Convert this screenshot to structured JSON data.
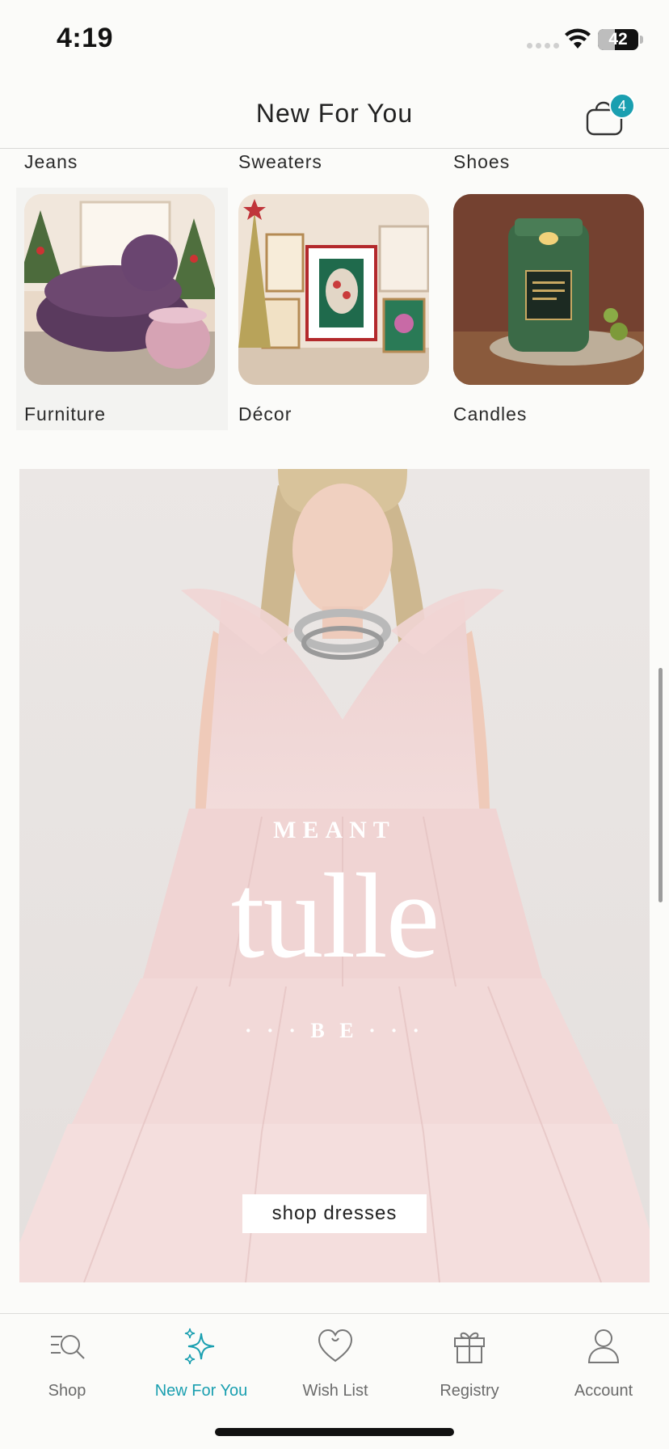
{
  "status_bar": {
    "time": "4:19",
    "battery": "42",
    "battery_level": 0.42
  },
  "header": {
    "title": "New For You",
    "cart_count": "4"
  },
  "categories": {
    "top_row": [
      {
        "label": "Jeans"
      },
      {
        "label": "Sweaters"
      },
      {
        "label": "Shoes"
      }
    ],
    "items": [
      {
        "label": "Furniture",
        "icon": "furniture-photo"
      },
      {
        "label": "Décor",
        "icon": "decor-photo"
      },
      {
        "label": "Candles",
        "icon": "candles-photo"
      }
    ]
  },
  "banner": {
    "line1": "MEANT",
    "line2": "tulle",
    "line3": "· · · B E · · ·",
    "button_label": "shop dresses"
  },
  "tabbar": {
    "tabs": [
      {
        "label": "Shop",
        "icon": "shop-search-icon"
      },
      {
        "label": "New For You",
        "icon": "sparkle-icon",
        "active": true
      },
      {
        "label": "Wish List",
        "icon": "heart-icon"
      },
      {
        "label": "Registry",
        "icon": "gift-icon"
      },
      {
        "label": "Account",
        "icon": "person-icon"
      }
    ],
    "accent": "#1a9fb0"
  }
}
